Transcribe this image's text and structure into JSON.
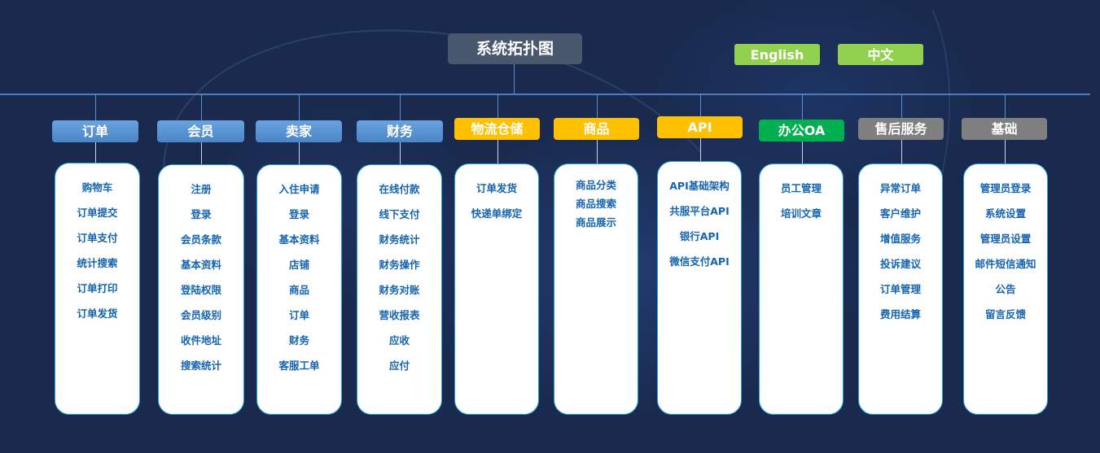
{
  "root": {
    "title": "系统拓扑图"
  },
  "languages": {
    "english": "English",
    "chinese": "中文"
  },
  "colors": {
    "background": "#1a2a4e",
    "title_bg": "#4a586e",
    "lang_button": "#92d050",
    "blue": "#5b95d6",
    "yellow": "#ffc000",
    "green": "#00b050",
    "gray": "#7f7f7f",
    "card_border": "#1fa3e0",
    "item_text": "#1564b0"
  },
  "categories": [
    {
      "label": "订单",
      "color": "blue",
      "items": [
        "购物车",
        "订单提交",
        "订单支付",
        "统计搜索",
        "订单打印",
        "订单发货"
      ]
    },
    {
      "label": "会员",
      "color": "blue",
      "items": [
        "注册",
        "登录",
        "会员条款",
        "基本资料",
        "登陆权限",
        "会员级别",
        "收件地址",
        "搜索统计"
      ]
    },
    {
      "label": "卖家",
      "color": "blue",
      "items": [
        "入住申请",
        "登录",
        "基本资料",
        "店铺",
        "商品",
        "订单",
        "财务",
        "客服工单"
      ]
    },
    {
      "label": "财务",
      "color": "blue",
      "items": [
        "在线付款",
        "线下支付",
        "财务统计",
        "财务操作",
        "财务对账",
        "营收报表",
        "应收",
        "应付"
      ]
    },
    {
      "label": "物流仓储",
      "color": "yellow",
      "items": [
        "订单发货",
        "快递单绑定"
      ]
    },
    {
      "label": "商品",
      "color": "yellow",
      "items": [
        "商品分类",
        "商品搜索",
        "商品展示"
      ]
    },
    {
      "label": "API",
      "color": "yellow",
      "items": [
        "API基础架构",
        "共服平台API",
        "银行API",
        "微信支付API"
      ]
    },
    {
      "label": "办公OA",
      "color": "green",
      "items": [
        "员工管理",
        "培训文章"
      ]
    },
    {
      "label": "售后服务",
      "color": "gray",
      "items": [
        "异常订单",
        "客户维护",
        "增值服务",
        "投诉建议",
        "订单管理",
        "费用结算"
      ]
    },
    {
      "label": "基础",
      "color": "gray",
      "items": [
        "管理员登录",
        "系统设置",
        "管理员设置",
        "邮件短信通知",
        "公告",
        "留言反馈"
      ]
    }
  ]
}
